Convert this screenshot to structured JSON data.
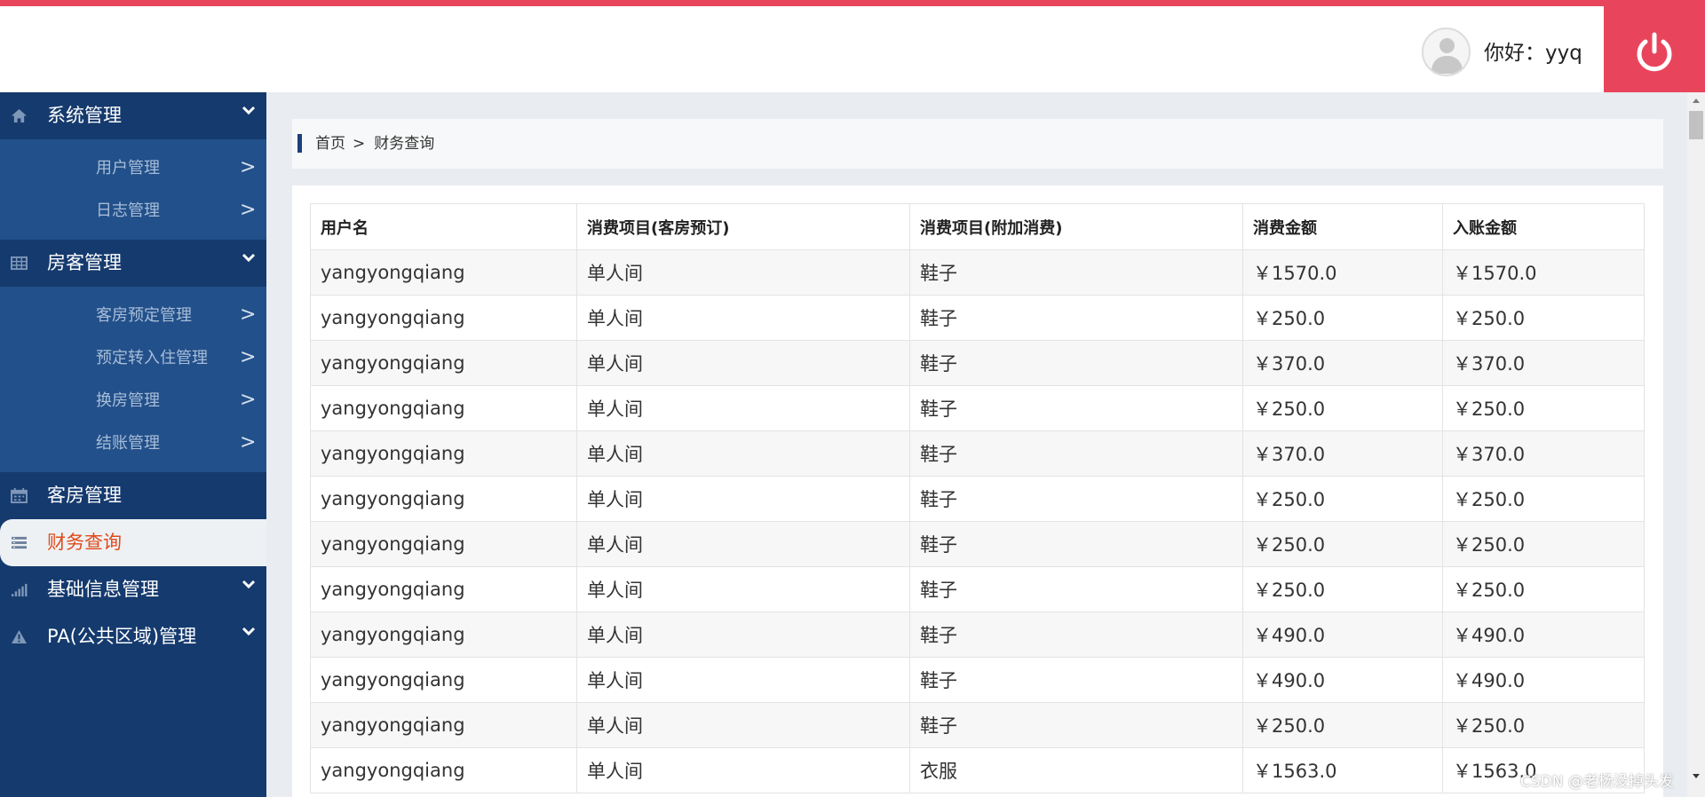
{
  "header": {
    "greeting": "你好：yyq",
    "logout_icon": "power-icon"
  },
  "colors": {
    "accent": "#e8455c",
    "sidebar": "#153a6e",
    "submenu": "#22508a",
    "active_text": "#e04a1a"
  },
  "sidebar": {
    "groups": [
      {
        "label": "系统管理",
        "icon": "home-icon",
        "items": [
          "用户管理",
          "日志管理"
        ]
      },
      {
        "label": "房客管理",
        "icon": "table-icon",
        "items": [
          "客房预定管理",
          "预定转入住管理",
          "换房管理",
          "结账管理"
        ]
      },
      {
        "label": "客房管理",
        "icon": "calendar-icon"
      },
      {
        "label": "财务查询",
        "icon": "list-icon",
        "active": true
      },
      {
        "label": "基础信息管理",
        "icon": "signal-icon"
      },
      {
        "label": "PA(公共区域)管理",
        "icon": "warning-icon"
      }
    ],
    "arrow": ">"
  },
  "breadcrumb": {
    "home": "首页",
    "separator": ">",
    "current": "财务查询"
  },
  "table": {
    "columns": [
      "用户名",
      "消费项目(客房预订)",
      "消费项目(附加消费)",
      "消费金额",
      "入账金额"
    ],
    "rows": [
      [
        "yangyongqiang",
        "单人间",
        "鞋子",
        "￥1570.0",
        "￥1570.0"
      ],
      [
        "yangyongqiang",
        "单人间",
        "鞋子",
        "￥250.0",
        "￥250.0"
      ],
      [
        "yangyongqiang",
        "单人间",
        "鞋子",
        "￥370.0",
        "￥370.0"
      ],
      [
        "yangyongqiang",
        "单人间",
        "鞋子",
        "￥250.0",
        "￥250.0"
      ],
      [
        "yangyongqiang",
        "单人间",
        "鞋子",
        "￥370.0",
        "￥370.0"
      ],
      [
        "yangyongqiang",
        "单人间",
        "鞋子",
        "￥250.0",
        "￥250.0"
      ],
      [
        "yangyongqiang",
        "单人间",
        "鞋子",
        "￥250.0",
        "￥250.0"
      ],
      [
        "yangyongqiang",
        "单人间",
        "鞋子",
        "￥250.0",
        "￥250.0"
      ],
      [
        "yangyongqiang",
        "单人间",
        "鞋子",
        "￥490.0",
        "￥490.0"
      ],
      [
        "yangyongqiang",
        "单人间",
        "鞋子",
        "￥490.0",
        "￥490.0"
      ],
      [
        "yangyongqiang",
        "单人间",
        "鞋子",
        "￥250.0",
        "￥250.0"
      ],
      [
        "yangyongqiang",
        "单人间",
        "衣服",
        "￥1563.0",
        "￥1563.0"
      ]
    ]
  },
  "watermark": "CSDN @老杨没掉头发"
}
